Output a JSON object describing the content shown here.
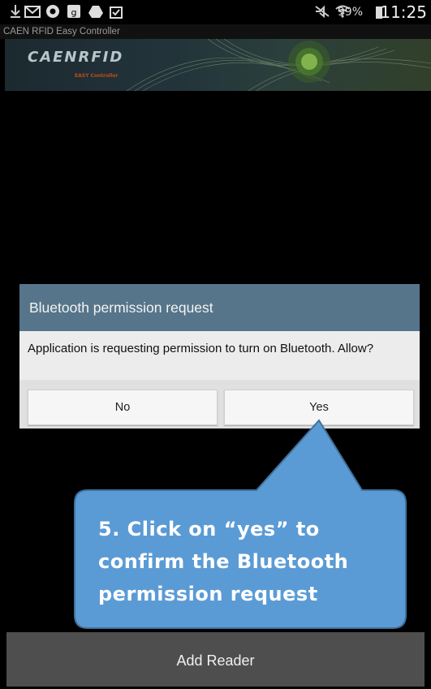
{
  "status_bar": {
    "battery": "99%",
    "time": "11:25",
    "icons": [
      "download-icon",
      "gmail-icon",
      "chrome-icon",
      "google-plus-icon",
      "drive-icon",
      "shopping-icon",
      "mute-icon",
      "wifi-icon",
      "battery-icon"
    ]
  },
  "app": {
    "title": "CAEN RFID Easy Controller",
    "banner_logo": "CAENRFID",
    "banner_sub": "EASY Controller"
  },
  "dialog": {
    "title": "Bluetooth permission request",
    "message": "Application is requesting permission to turn on Bluetooth. Allow?",
    "no_label": "No",
    "yes_label": "Yes"
  },
  "bottom": {
    "add_reader_label": "Add Reader"
  },
  "callout": {
    "lines": [
      "5. Click on “yes” to",
      "confirm the Bluetooth",
      "permission request"
    ],
    "fill": "#5b9bd5",
    "stroke": "#41719c"
  }
}
